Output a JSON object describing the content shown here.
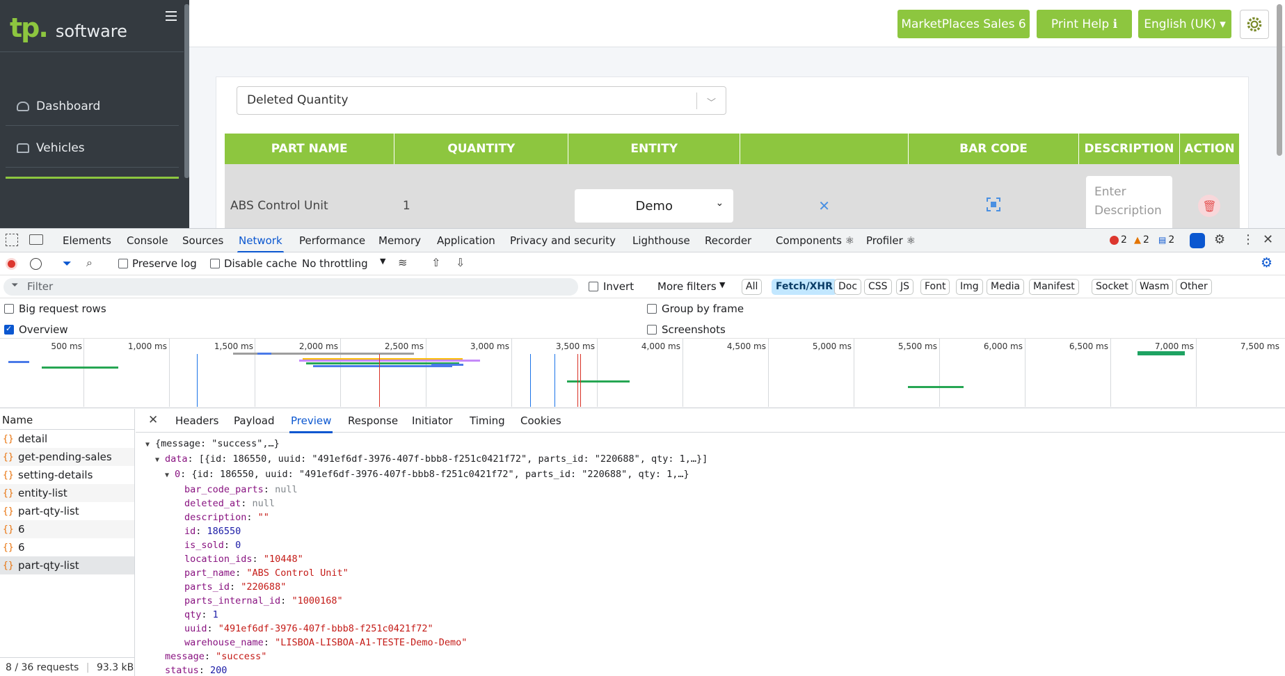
{
  "app": {
    "logo_mark": "tp.",
    "logo_text": "software",
    "sidebar_items": [
      {
        "label": "Dashboard",
        "icon": "gauge-icon"
      },
      {
        "label": "Vehicles",
        "icon": "car-icon"
      }
    ],
    "top_buttons": {
      "marketplaces": "MarketPlaces Sales 6",
      "print_help": "Print Help ℹ",
      "language": "English (UK) ▾"
    },
    "status_select": "Deleted Quantity",
    "table": {
      "headers": [
        "PART NAME",
        "QUANTITY",
        "ENTITY",
        "",
        "BAR CODE",
        "DESCRIPTION",
        "ACTION"
      ],
      "row": {
        "part_name": "ABS Control Unit",
        "quantity": "1",
        "entity": "Demo",
        "description_placeholder": "Enter Description"
      }
    },
    "colors": {
      "brand": "#8dc63f",
      "sidebar": "#343a40"
    }
  },
  "devtools": {
    "tabs": [
      "Elements",
      "Console",
      "Sources",
      "Network",
      "Performance",
      "Memory",
      "Application",
      "Privacy and security",
      "Lighthouse",
      "Recorder",
      "Components ⚛",
      "Profiler ⚛"
    ],
    "active_tab": "Network",
    "errors": "2",
    "warnings": "2",
    "messages": "2",
    "toolbar": {
      "preserve_log": "Preserve log",
      "disable_cache": "Disable cache",
      "throttling": "No throttling"
    },
    "filter": {
      "placeholder": "Filter",
      "invert": "Invert",
      "more_filters": "More filters",
      "types": [
        "All",
        "Fetch/XHR",
        "Doc",
        "CSS",
        "JS",
        "Font",
        "Img",
        "Media",
        "Manifest",
        "Socket",
        "Wasm",
        "Other"
      ],
      "selected_type": "Fetch/XHR"
    },
    "settings": {
      "big_request_rows": "Big request rows",
      "overview": "Overview",
      "group_by_frame": "Group by frame",
      "screenshots": "Screenshots"
    },
    "timeline_ticks": [
      "500 ms",
      "1,000 ms",
      "1,500 ms",
      "2,000 ms",
      "2,500 ms",
      "3,000 ms",
      "3,500 ms",
      "4,000 ms",
      "4,500 ms",
      "5,000 ms",
      "5,500 ms",
      "6,000 ms",
      "6,500 ms",
      "7,000 ms",
      "7,500 ms"
    ],
    "requests_header": "Name",
    "requests": [
      "detail",
      "get-pending-sales",
      "setting-details",
      "entity-list",
      "part-qty-list",
      "6",
      "6",
      "part-qty-list"
    ],
    "requests_status": "8 / 36 requests",
    "transfer_status": "93.3 kB /",
    "detail_tabs": [
      "Headers",
      "Payload",
      "Preview",
      "Response",
      "Initiator",
      "Timing",
      "Cookies"
    ],
    "active_detail_tab": "Preview",
    "preview": {
      "root": "{message: \"success\",…}",
      "data_summary": "[{id: 186550, uuid: \"491ef6df-3976-407f-bbb8-f251c0421f72\", parts_id: \"220688\", qty: 1,…}]",
      "item0_summary": "{id: 186550, uuid: \"491ef6df-3976-407f-bbb8-f251c0421f72\", parts_id: \"220688\", qty: 1,…}",
      "fields": [
        {
          "key": "bar_code_parts",
          "value": "null",
          "type": "null"
        },
        {
          "key": "deleted_at",
          "value": "null",
          "type": "null"
        },
        {
          "key": "description",
          "value": "\"\"",
          "type": "string"
        },
        {
          "key": "id",
          "value": "186550",
          "type": "number"
        },
        {
          "key": "is_sold",
          "value": "0",
          "type": "number"
        },
        {
          "key": "location_ids",
          "value": "\"10448\"",
          "type": "string"
        },
        {
          "key": "part_name",
          "value": "\"ABS Control Unit\"",
          "type": "string"
        },
        {
          "key": "parts_id",
          "value": "\"220688\"",
          "type": "string"
        },
        {
          "key": "parts_internal_id",
          "value": "\"1000168\"",
          "type": "string"
        },
        {
          "key": "qty",
          "value": "1",
          "type": "number"
        },
        {
          "key": "uuid",
          "value": "\"491ef6df-3976-407f-bbb8-f251c0421f72\"",
          "type": "string"
        },
        {
          "key": "warehouse_name",
          "value": "\"LISBOA-LISBOA-A1-TESTE-Demo-Demo\"",
          "type": "string"
        }
      ],
      "message": "\"success\"",
      "status": "200"
    }
  }
}
